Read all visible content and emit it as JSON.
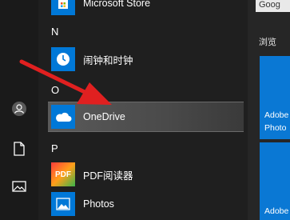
{
  "start_menu": {
    "apps": [
      {
        "label": "Microsoft Store",
        "icon": "store-icon",
        "tile_color": "#0078d7"
      },
      {
        "label": "闹钟和时钟",
        "icon": "alarm-clock-icon",
        "tile_color": "#0078d7"
      },
      {
        "label": "OneDrive",
        "icon": "onedrive-cloud-icon",
        "tile_color": "#0078d7",
        "selected": true
      },
      {
        "label": "PDF阅读器",
        "icon": "pdf-reader-icon",
        "tile_color": "#f29400"
      },
      {
        "label": "Photos",
        "icon": "photos-icon",
        "tile_color": "#0078d7"
      }
    ],
    "section_letters": [
      "N",
      "O",
      "P"
    ]
  },
  "rail": {
    "icons": [
      "user-avatar-icon",
      "document-icon",
      "pictures-icon"
    ]
  },
  "tiles": {
    "search_text": "Goog",
    "group_label": "浏览",
    "tile_texts": [
      "Adobe",
      "Photo",
      "Adobe"
    ]
  },
  "annotation": {
    "arrow_color": "#e02020"
  }
}
